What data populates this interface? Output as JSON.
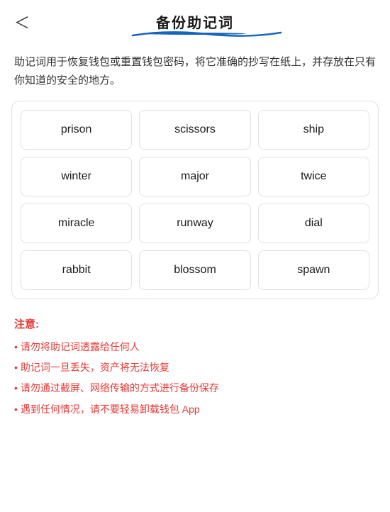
{
  "header": {
    "back_label": "‹",
    "title": "备份助记词"
  },
  "description": "助记词用于恢复钱包或重置钱包密码，将它准确的抄写在纸上，并存放在只有你知道的安全的地方。",
  "mnemonic_grid": {
    "words": [
      "prison",
      "scissors",
      "ship",
      "winter",
      "major",
      "twice",
      "miracle",
      "runway",
      "dial",
      "rabbit",
      "blossom",
      "spawn"
    ]
  },
  "notice": {
    "title": "注意:",
    "items": [
      "请勿将助记词透露给任何人",
      "助记词一旦丢失，资产将无法恢复",
      "请勿通过截屏、网络传输的方式进行备份保存",
      "遇到任何情况，请不要轻易卸载钱包 App"
    ]
  }
}
